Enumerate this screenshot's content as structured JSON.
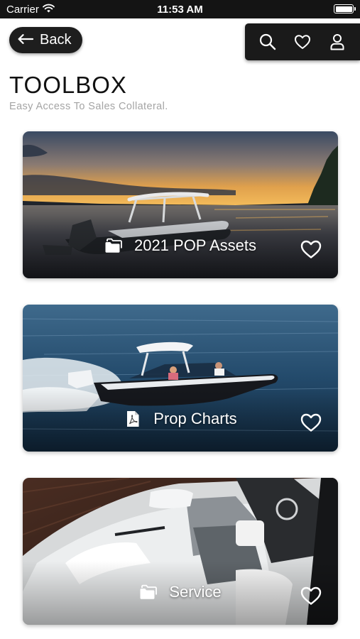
{
  "status_bar": {
    "carrier": "Carrier",
    "time": "11:53 AM",
    "battery_level": 1.0
  },
  "nav": {
    "back_label": "Back",
    "actions": [
      {
        "icon": "search-icon"
      },
      {
        "icon": "heart-icon"
      },
      {
        "icon": "user-icon"
      }
    ]
  },
  "header": {
    "title": "TOOLBOX",
    "subtitle": "Easy Access To Sales Collateral."
  },
  "cards": [
    {
      "label": "2021 POP Assets",
      "icon": "folder-icon",
      "favorite_icon": "heart-outline-icon"
    },
    {
      "label": "Prop Charts",
      "icon": "pdf-icon",
      "favorite_icon": "heart-outline-icon"
    },
    {
      "label": "Service",
      "icon": "folder-icon",
      "favorite_icon": "heart-outline-icon"
    }
  ],
  "colors": {
    "status_bar_bg": "#141414",
    "toolbar_bg": "#1a1a1a",
    "subtitle_gray": "#a4a4a4",
    "text_white": "#ffffff"
  }
}
